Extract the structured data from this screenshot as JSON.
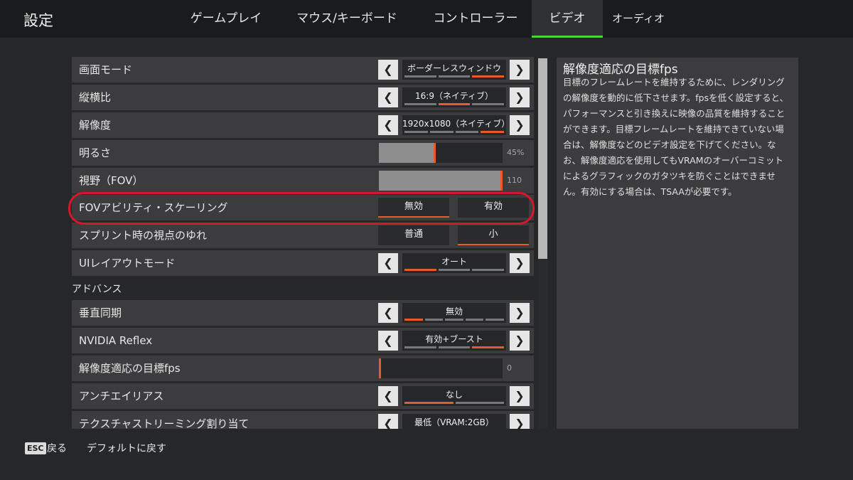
{
  "header": {
    "title": "設定",
    "tabs": [
      {
        "label": "ゲームプレイ"
      },
      {
        "label": "マウス/キーボード"
      },
      {
        "label": "コントローラー"
      },
      {
        "label": "ビデオ"
      },
      {
        "label": "オーディオ"
      }
    ]
  },
  "settings": {
    "display_mode": {
      "label": "画面モード",
      "value": "ボーダーレスウィンドウ"
    },
    "aspect_ratio": {
      "label": "縦横比",
      "value": "16:9（ネイティブ）"
    },
    "resolution": {
      "label": "解像度",
      "value": "1920x1080（ネイティブ）"
    },
    "brightness": {
      "label": "明るさ",
      "value": "45%",
      "level": 0.45
    },
    "fov": {
      "label": "視野（FOV）",
      "value": "110",
      "level": 1.0
    },
    "fov_ability_scaling": {
      "label": "FOVアビリティ・スケーリング",
      "option_a": "無効",
      "option_b": "有効"
    },
    "sprint_view_shake": {
      "label": "スプリント時の視点のゆれ",
      "option_a": "普通",
      "option_b": "小"
    },
    "ui_layout_mode": {
      "label": "UIレイアウトモード",
      "value": "オート"
    }
  },
  "advanced": {
    "heading": "アドバンス",
    "vsync": {
      "label": "垂直同期",
      "value": "無効"
    },
    "nvidia_reflex": {
      "label": "NVIDIA Reflex",
      "value": "有効+ブースト"
    },
    "adaptive_res_fps": {
      "label": "解像度適応の目標fps",
      "value": "0",
      "level": 0.0
    },
    "anti_aliasing": {
      "label": "アンチエイリアス",
      "value": "なし"
    },
    "texture_streaming": {
      "label": "テクスチャストリーミング割り当て",
      "value": "最低（VRAM:2GB）"
    }
  },
  "description": {
    "title": "解像度適応の目標fps",
    "body": "目標のフレームレートを維持するために、レンダリングの解像度を動的に低下させます。fpsを低く設定すると、パフォーマンスと引き換えに映像の品質を維持することができます。目標フレームレートを維持できていない場合は、解像度などのビデオ設定を下げてください。なお、解像度適応を使用してもVRAMのオーバーコミットによるグラフィックのガタツキを防ぐことはできません。有効にする場合は、TSAAが必要です。"
  },
  "footer": {
    "esc_key": "ESC",
    "back_label": "戻る",
    "reset_label": "デフォルトに戻す"
  },
  "colors": {
    "accent": "#e85a2a",
    "tab_active": "#4cd137",
    "highlight": "#d6162a"
  }
}
